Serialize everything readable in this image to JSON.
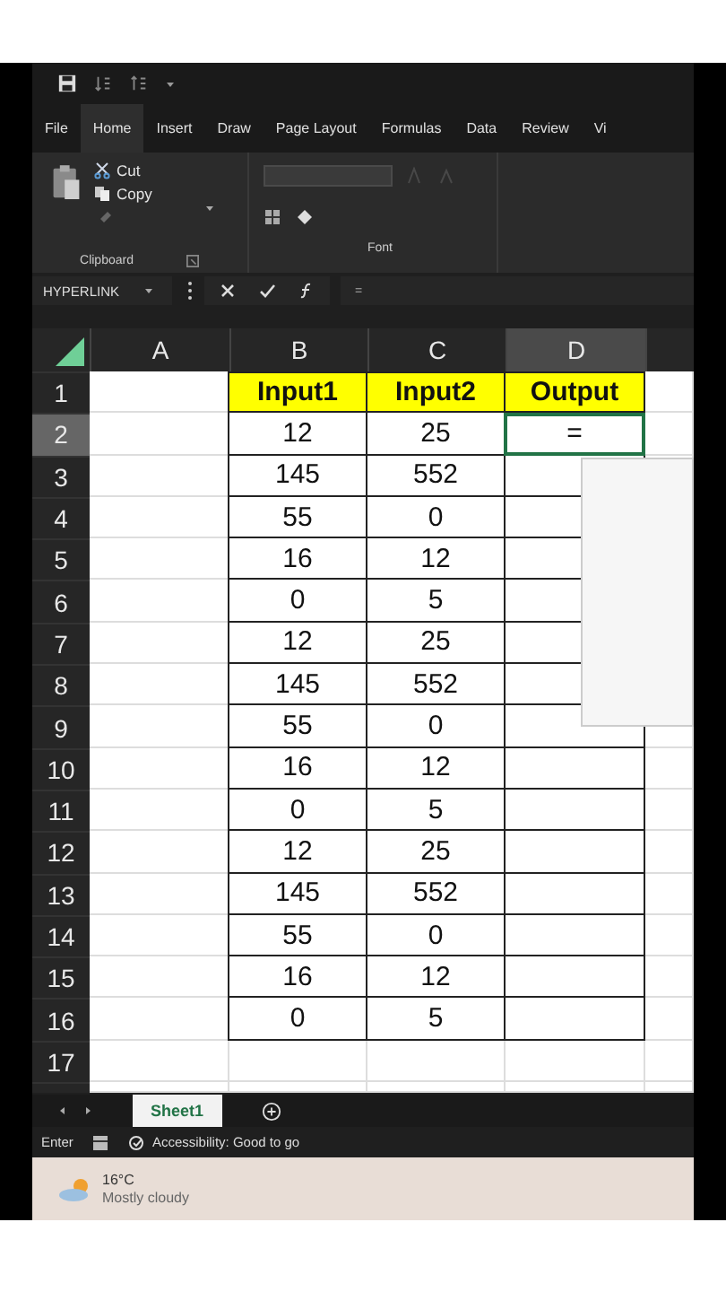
{
  "ribbon_tabs": [
    {
      "label": "File",
      "selected": false
    },
    {
      "label": "Home",
      "selected": true
    },
    {
      "label": "Insert",
      "selected": false
    },
    {
      "label": "Draw",
      "selected": false
    },
    {
      "label": "Page Layout",
      "selected": false
    },
    {
      "label": "Formulas",
      "selected": false
    },
    {
      "label": "Data",
      "selected": false
    },
    {
      "label": "Review",
      "selected": false
    },
    {
      "label": "Vi",
      "selected": false
    }
  ],
  "clipboard": {
    "cut": "Cut",
    "copy": "Copy",
    "label": "Clipboard"
  },
  "font_group": {
    "label": "Font"
  },
  "formula_bar": {
    "name_box": "HYPERLINK",
    "value": "="
  },
  "columns": [
    {
      "label": "A",
      "selected": false
    },
    {
      "label": "B",
      "selected": false
    },
    {
      "label": "C",
      "selected": false
    },
    {
      "label": "D",
      "selected": true
    }
  ],
  "header_row": {
    "number": "1",
    "cells": [
      "Input1",
      "Input2",
      "Output"
    ]
  },
  "rows": [
    {
      "number": "2",
      "selected": true,
      "input1": "12",
      "input2": "25",
      "output": "="
    },
    {
      "number": "3",
      "selected": false,
      "input1": "145",
      "input2": "552"
    },
    {
      "number": "4",
      "selected": false,
      "input1": "55",
      "input2": "0"
    },
    {
      "number": "5",
      "selected": false,
      "input1": "16",
      "input2": "12"
    },
    {
      "number": "6",
      "selected": false,
      "input1": "0",
      "input2": "5"
    },
    {
      "number": "7",
      "selected": false,
      "input1": "12",
      "input2": "25"
    },
    {
      "number": "8",
      "selected": false,
      "input1": "145",
      "input2": "552"
    },
    {
      "number": "9",
      "selected": false,
      "input1": "55",
      "input2": "0"
    },
    {
      "number": "10",
      "selected": false,
      "input1": "16",
      "input2": "12"
    },
    {
      "number": "11",
      "selected": false,
      "input1": "0",
      "input2": "5"
    },
    {
      "number": "12",
      "selected": false,
      "input1": "12",
      "input2": "25"
    },
    {
      "number": "13",
      "selected": false,
      "input1": "145",
      "input2": "552"
    },
    {
      "number": "14",
      "selected": false,
      "input1": "55",
      "input2": "0"
    },
    {
      "number": "15",
      "selected": false,
      "input1": "16",
      "input2": "12"
    },
    {
      "number": "16",
      "selected": false,
      "input1": "0",
      "input2": "5"
    },
    {
      "number": "17",
      "selected": false
    }
  ],
  "sheet_tabs": [
    {
      "label": "Sheet1",
      "selected": true
    }
  ],
  "status_bar": {
    "mode": "Enter",
    "accessibility": "Accessibility: Good to go"
  },
  "weather": {
    "temperature": "16°C",
    "condition": "Mostly cloudy"
  }
}
